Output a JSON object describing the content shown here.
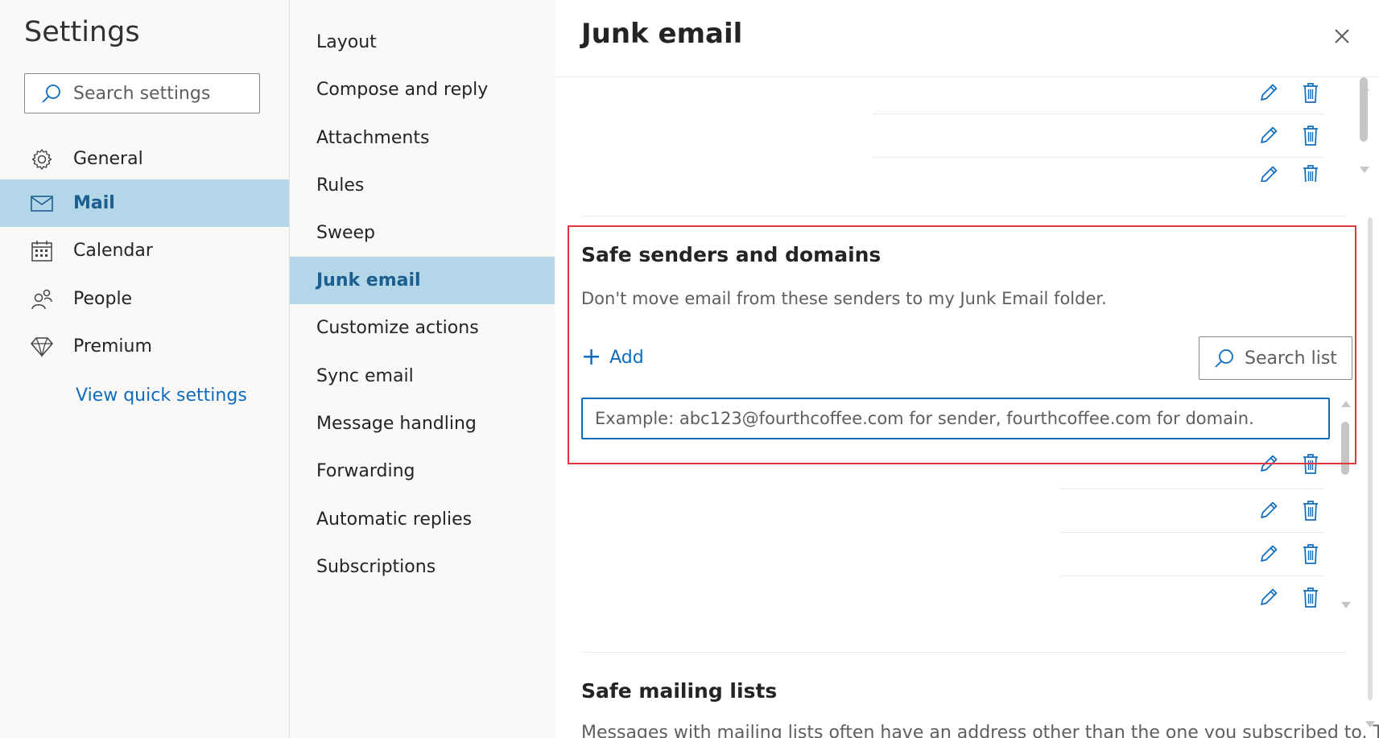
{
  "sidebar": {
    "title": "Settings",
    "search_placeholder": "Search settings",
    "items": [
      {
        "label": "General",
        "icon": "gear-icon"
      },
      {
        "label": "Mail",
        "icon": "mail-icon",
        "selected": true
      },
      {
        "label": "Calendar",
        "icon": "calendar-icon"
      },
      {
        "label": "People",
        "icon": "people-icon"
      },
      {
        "label": "Premium",
        "icon": "diamond-icon"
      }
    ],
    "quick_settings_link": "View quick settings"
  },
  "subnav": {
    "items": [
      {
        "label": "Layout"
      },
      {
        "label": "Compose and reply"
      },
      {
        "label": "Attachments"
      },
      {
        "label": "Rules"
      },
      {
        "label": "Sweep"
      },
      {
        "label": "Junk email",
        "selected": true
      },
      {
        "label": "Customize actions"
      },
      {
        "label": "Sync email"
      },
      {
        "label": "Message handling"
      },
      {
        "label": "Forwarding"
      },
      {
        "label": "Automatic replies"
      },
      {
        "label": "Subscriptions"
      }
    ]
  },
  "main": {
    "title": "Junk email",
    "safe_senders": {
      "title": "Safe senders and domains",
      "description": "Don't move email from these senders to my Junk Email folder.",
      "add_label": "Add",
      "search_list_label": "Search list",
      "input_placeholder": "Example: abc123@fourthcoffee.com for sender, fourthcoffee.com for domain."
    },
    "safe_mailing_lists": {
      "title": "Safe mailing lists",
      "description_partial": "Messages with mailing lists often have an address other than the one you subscribed to. To"
    }
  },
  "colors": {
    "selected_background": "#b3d6e8",
    "accent": "#0f6cbd",
    "highlight_border": "#e0373e"
  }
}
